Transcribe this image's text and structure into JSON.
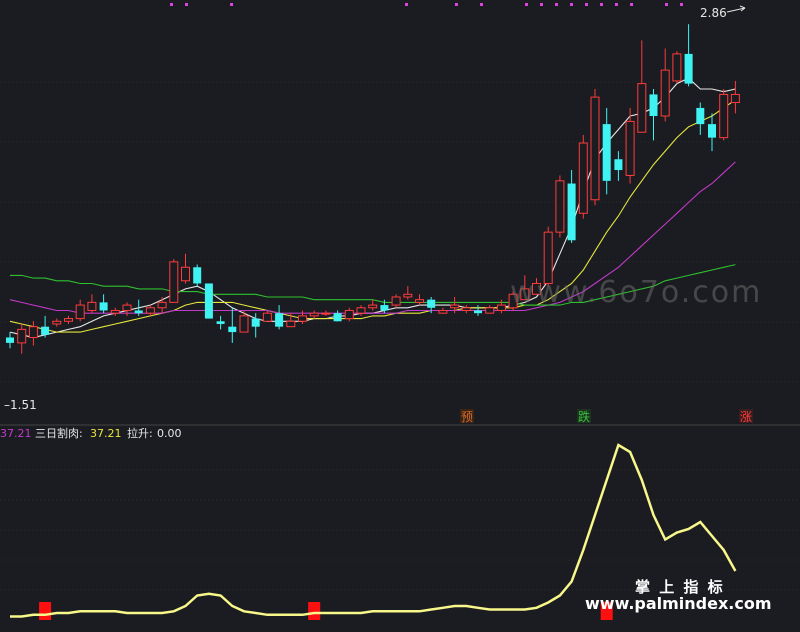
{
  "colors": {
    "background": "#1b1c21",
    "grid": "#3a3a3a",
    "candle_up": "#ff3b3b",
    "candle_down": "#3ff3f3",
    "ma_white": "#e8e8e8",
    "ma_yellow": "#e6e63c",
    "ma_magenta": "#c13ac8",
    "ma_green": "#2ec02e",
    "indicator_line": "#f7f78a",
    "signal_bar": "#ff1010",
    "legend_label": "#e6e6e6",
    "legend_value": "#e6e63c",
    "left_value": "#c13ac8",
    "tag_pre": "#d46a2a",
    "tag_fall": "#37c23a",
    "tag_rise": "#ff3b3b"
  },
  "price_panel": {
    "high_label": "2.86",
    "low_label": "1.51",
    "marker_tags": [
      {
        "text": "预",
        "type": "pre"
      },
      {
        "text": "跌",
        "type": "fall"
      },
      {
        "text": "涨",
        "type": "rise"
      }
    ]
  },
  "indicator_panel": {
    "left_value": "37.21",
    "series_name": "三日割肉:",
    "series_value": "37.21",
    "second_name": "拉升:",
    "second_value": "0.00"
  },
  "watermarks": {
    "top": "www.6o7o.com",
    "bottom_cn": "掌 上 指 标",
    "bottom_url": "www.palmindex.com"
  },
  "chart_data": {
    "type": "candlestick",
    "title": "",
    "ylim": [
      1.45,
      2.92
    ],
    "candles": [
      [
        1.7,
        1.68,
        1.72,
        1.66
      ],
      [
        1.68,
        1.73,
        1.75,
        1.64
      ],
      [
        1.7,
        1.74,
        1.76,
        1.67
      ],
      [
        1.74,
        1.71,
        1.78,
        1.7
      ],
      [
        1.75,
        1.76,
        1.77,
        1.74
      ],
      [
        1.76,
        1.77,
        1.78,
        1.75
      ],
      [
        1.77,
        1.82,
        1.84,
        1.76
      ],
      [
        1.8,
        1.83,
        1.86,
        1.79
      ],
      [
        1.83,
        1.8,
        1.86,
        1.79
      ],
      [
        1.79,
        1.8,
        1.81,
        1.78
      ],
      [
        1.8,
        1.82,
        1.83,
        1.78
      ],
      [
        1.8,
        1.79,
        1.84,
        1.78
      ],
      [
        1.79,
        1.81,
        1.82,
        1.78
      ],
      [
        1.81,
        1.83,
        1.85,
        1.79
      ],
      [
        1.83,
        1.98,
        1.99,
        1.83
      ],
      [
        1.91,
        1.96,
        2.01,
        1.9
      ],
      [
        1.96,
        1.9,
        1.97,
        1.89
      ],
      [
        1.9,
        1.77,
        1.9,
        1.77
      ],
      [
        1.76,
        1.75,
        1.78,
        1.73
      ],
      [
        1.74,
        1.72,
        1.81,
        1.68
      ],
      [
        1.72,
        1.78,
        1.8,
        1.72
      ],
      [
        1.77,
        1.74,
        1.79,
        1.7
      ],
      [
        1.76,
        1.79,
        1.8,
        1.76
      ],
      [
        1.79,
        1.74,
        1.82,
        1.73
      ],
      [
        1.74,
        1.76,
        1.79,
        1.74
      ],
      [
        1.76,
        1.78,
        1.8,
        1.75
      ],
      [
        1.78,
        1.79,
        1.8,
        1.77
      ],
      [
        1.79,
        1.79,
        1.8,
        1.78
      ],
      [
        1.79,
        1.76,
        1.8,
        1.76
      ],
      [
        1.77,
        1.8,
        1.81,
        1.76
      ],
      [
        1.79,
        1.81,
        1.82,
        1.78
      ],
      [
        1.81,
        1.82,
        1.84,
        1.8
      ],
      [
        1.82,
        1.8,
        1.84,
        1.79
      ],
      [
        1.82,
        1.85,
        1.86,
        1.81
      ],
      [
        1.85,
        1.86,
        1.89,
        1.84
      ],
      [
        1.83,
        1.84,
        1.86,
        1.82
      ],
      [
        1.84,
        1.81,
        1.85,
        1.79
      ],
      [
        1.79,
        1.8,
        1.81,
        1.79
      ],
      [
        1.81,
        1.82,
        1.85,
        1.79
      ],
      [
        1.8,
        1.81,
        1.82,
        1.79
      ],
      [
        1.8,
        1.79,
        1.82,
        1.78
      ],
      [
        1.79,
        1.81,
        1.82,
        1.79
      ],
      [
        1.8,
        1.82,
        1.84,
        1.79
      ],
      [
        1.81,
        1.86,
        1.87,
        1.8
      ],
      [
        1.84,
        1.88,
        1.93,
        1.84
      ],
      [
        1.86,
        1.9,
        1.92,
        1.86
      ],
      [
        1.9,
        2.09,
        2.11,
        1.89
      ],
      [
        2.09,
        2.28,
        2.3,
        2.07
      ],
      [
        2.27,
        2.06,
        2.32,
        2.05
      ],
      [
        2.16,
        2.42,
        2.45,
        2.14
      ],
      [
        2.21,
        2.59,
        2.62,
        2.19
      ],
      [
        2.49,
        2.28,
        2.55,
        2.23
      ],
      [
        2.36,
        2.32,
        2.39,
        2.28
      ],
      [
        2.3,
        2.5,
        2.55,
        2.27
      ],
      [
        2.46,
        2.64,
        2.8,
        2.58
      ],
      [
        2.6,
        2.52,
        2.62,
        2.43
      ],
      [
        2.52,
        2.69,
        2.77,
        2.5
      ],
      [
        2.65,
        2.75,
        2.76,
        2.64
      ],
      [
        2.75,
        2.64,
        2.86,
        2.63
      ],
      [
        2.55,
        2.49,
        2.57,
        2.45
      ],
      [
        2.49,
        2.44,
        2.53,
        2.39
      ],
      [
        2.44,
        2.6,
        2.62,
        2.43
      ],
      [
        2.57,
        2.6,
        2.65,
        2.53
      ]
    ],
    "ma_lines": [
      {
        "values": [
          1.72,
          1.71,
          1.7,
          1.71,
          1.72,
          1.73,
          1.74,
          1.76,
          1.78,
          1.79,
          1.8,
          1.81,
          1.82,
          1.84,
          1.86,
          1.88,
          1.89,
          1.87,
          1.84,
          1.81,
          1.79,
          1.77,
          1.76,
          1.76,
          1.76,
          1.76,
          1.77,
          1.77,
          1.78,
          1.78,
          1.79,
          1.79,
          1.8,
          1.81,
          1.81,
          1.82,
          1.82,
          1.82,
          1.82,
          1.81,
          1.81,
          1.81,
          1.81,
          1.82,
          1.83,
          1.85,
          1.91,
          2.01,
          2.11,
          2.24,
          2.36,
          2.42,
          2.47,
          2.52,
          2.53,
          2.55,
          2.59,
          2.64,
          2.66,
          2.62,
          2.62,
          2.61,
          2.62
        ]
      },
      {
        "values": [
          1.76,
          1.75,
          1.74,
          1.73,
          1.72,
          1.72,
          1.72,
          1.73,
          1.74,
          1.75,
          1.76,
          1.77,
          1.78,
          1.79,
          1.8,
          1.82,
          1.83,
          1.83,
          1.83,
          1.83,
          1.82,
          1.81,
          1.8,
          1.79,
          1.78,
          1.77,
          1.77,
          1.77,
          1.77,
          1.77,
          1.77,
          1.78,
          1.78,
          1.79,
          1.79,
          1.79,
          1.8,
          1.8,
          1.8,
          1.81,
          1.81,
          1.81,
          1.81,
          1.81,
          1.82,
          1.82,
          1.84,
          1.87,
          1.9,
          1.95,
          2.02,
          2.09,
          2.15,
          2.22,
          2.28,
          2.34,
          2.39,
          2.44,
          2.48,
          2.5,
          2.52,
          2.55,
          2.58
        ]
      },
      {
        "values": [
          1.84,
          1.83,
          1.82,
          1.81,
          1.8,
          1.8,
          1.79,
          1.79,
          1.79,
          1.79,
          1.79,
          1.79,
          1.79,
          1.79,
          1.8,
          1.8,
          1.8,
          1.8,
          1.8,
          1.8,
          1.8,
          1.8,
          1.8,
          1.79,
          1.79,
          1.79,
          1.79,
          1.79,
          1.79,
          1.79,
          1.79,
          1.79,
          1.79,
          1.79,
          1.8,
          1.8,
          1.8,
          1.8,
          1.8,
          1.8,
          1.8,
          1.8,
          1.8,
          1.8,
          1.8,
          1.81,
          1.82,
          1.83,
          1.85,
          1.87,
          1.9,
          1.93,
          1.96,
          2.0,
          2.04,
          2.08,
          2.12,
          2.16,
          2.2,
          2.24,
          2.27,
          2.31,
          2.35
        ]
      },
      {
        "values": [
          1.93,
          1.93,
          1.92,
          1.92,
          1.91,
          1.91,
          1.9,
          1.9,
          1.89,
          1.89,
          1.89,
          1.88,
          1.88,
          1.88,
          1.87,
          1.87,
          1.87,
          1.86,
          1.86,
          1.86,
          1.86,
          1.86,
          1.85,
          1.85,
          1.85,
          1.85,
          1.84,
          1.84,
          1.84,
          1.84,
          1.84,
          1.84,
          1.83,
          1.83,
          1.83,
          1.83,
          1.83,
          1.83,
          1.83,
          1.83,
          1.83,
          1.83,
          1.83,
          1.83,
          1.82,
          1.82,
          1.82,
          1.82,
          1.83,
          1.83,
          1.84,
          1.85,
          1.86,
          1.87,
          1.88,
          1.89,
          1.91,
          1.92,
          1.93,
          1.94,
          1.95,
          1.96,
          1.97
        ]
      }
    ],
    "indicator": {
      "ylim": [
        0,
        100
      ],
      "values": [
        2,
        2,
        3,
        3,
        4,
        4,
        5,
        5,
        5,
        5,
        4,
        4,
        4,
        4,
        5,
        8,
        14,
        15,
        14,
        8,
        5,
        4,
        3,
        3,
        3,
        3,
        4,
        4,
        4,
        4,
        4,
        5,
        5,
        5,
        5,
        5,
        6,
        7,
        8,
        8,
        7,
        6,
        6,
        6,
        6,
        7,
        10,
        14,
        22,
        40,
        60,
        80,
        100,
        96,
        80,
        60,
        46,
        50,
        52,
        56,
        48,
        40,
        28
      ]
    },
    "signal_bars": [
      3,
      26,
      51
    ]
  }
}
